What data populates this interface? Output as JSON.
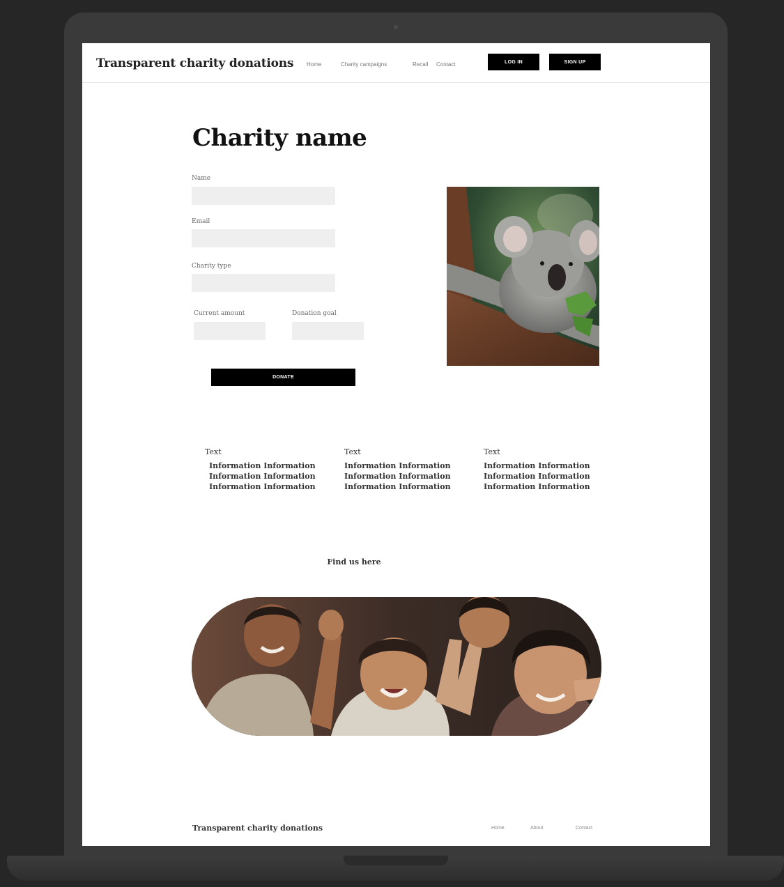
{
  "brand": "Transparent charity donations",
  "nav": {
    "links": [
      "Home",
      "Charity campaigns",
      "Recall",
      "Contact"
    ],
    "login_label": "LOG IN",
    "signup_label": "SIGN UP"
  },
  "page": {
    "title": "Charity name"
  },
  "form": {
    "name_label": "Name",
    "email_label": "Email",
    "charity_type_label": "Charity type",
    "current_amount_label": "Current amount",
    "donation_goal_label": "Donation goal",
    "donate_label": "DONATE"
  },
  "info_columns": [
    {
      "heading": "Text",
      "lines": [
        "Information Information",
        "Information Information",
        "Information Information"
      ]
    },
    {
      "heading": "Text",
      "lines": [
        "Information Information",
        "Information Information",
        "Information Information"
      ]
    },
    {
      "heading": "Text",
      "lines": [
        "Information Information",
        "Information Information",
        "Information Information"
      ]
    }
  ],
  "find_us": "Find us here",
  "footer": {
    "brand": "Transparent charity donations",
    "links": [
      "Home",
      "About",
      "Contact"
    ]
  }
}
